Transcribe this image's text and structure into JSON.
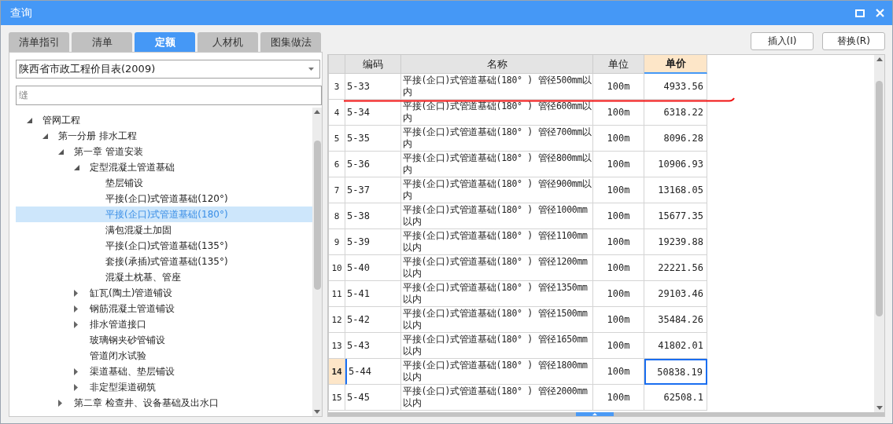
{
  "window": {
    "title": "查询"
  },
  "tabs": [
    {
      "label": "清单指引",
      "selected": false
    },
    {
      "label": "清单",
      "selected": false
    },
    {
      "label": "定额",
      "selected": true
    },
    {
      "label": "人材机",
      "selected": false
    },
    {
      "label": "图集做法",
      "selected": false
    }
  ],
  "buttons": [
    "插入(I)",
    "替换(R)"
  ],
  "library_dropdown": {
    "value": "陕西省市政工程价目表(2009)"
  },
  "search": {
    "value": "缝"
  },
  "tree": [
    {
      "label": "管网工程",
      "expanded": true,
      "selected": false,
      "children": [
        {
          "label": "第一分册 排水工程",
          "expanded": true,
          "selected": false,
          "children": [
            {
              "label": "第一章 管道安装",
              "expanded": true,
              "selected": false,
              "children": [
                {
                  "label": "定型混凝土管道基础",
                  "expanded": true,
                  "selected": false,
                  "children": [
                    {
                      "label": "垫层铺设",
                      "selected": false
                    },
                    {
                      "label": "平接(企口)式管道基础(120°)",
                      "selected": false
                    },
                    {
                      "label": "平接(企口)式管道基础(180°)",
                      "selected": true
                    },
                    {
                      "label": "满包混凝土加固",
                      "selected": false
                    },
                    {
                      "label": "平接(企口)式管道基础(135°)",
                      "selected": false
                    },
                    {
                      "label": "套接(承插)式管道基础(135°)",
                      "selected": false
                    },
                    {
                      "label": "混凝土枕基、管座",
                      "selected": false
                    }
                  ]
                },
                {
                  "label": "缸瓦(陶土)管道铺设",
                  "expanded": false,
                  "selected": false
                },
                {
                  "label": "钢筋混凝土管道铺设",
                  "expanded": false,
                  "selected": false
                },
                {
                  "label": "排水管道接口",
                  "expanded": false,
                  "selected": false
                },
                {
                  "label": "玻璃钢夹砂管铺设",
                  "selected": false
                },
                {
                  "label": "管道闭水试验",
                  "selected": false
                },
                {
                  "label": "渠道基础、垫层铺设",
                  "expanded": false,
                  "selected": false
                },
                {
                  "label": "非定型渠道砌筑",
                  "expanded": false,
                  "selected": false
                }
              ]
            },
            {
              "label": "第二章 检查井、设备基础及出水口",
              "expanded": false,
              "selected": false
            }
          ]
        }
      ]
    }
  ],
  "table": {
    "columns": [
      {
        "label": "编码",
        "selected": false
      },
      {
        "label": "名称",
        "selected": false
      },
      {
        "label": "单位",
        "selected": false
      },
      {
        "label": "单价",
        "selected": true
      }
    ],
    "rows": [
      {
        "index": "3",
        "code": "5-33",
        "name": "平接(企口)式管道基础(180° ) 管径500mm以内",
        "unit": "100m",
        "price": "4933.56",
        "selected": false
      },
      {
        "index": "4",
        "code": "5-34",
        "name": "平接(企口)式管道基础(180° ) 管径600mm以内",
        "unit": "100m",
        "price": "6318.22",
        "selected": false
      },
      {
        "index": "5",
        "code": "5-35",
        "name": "平接(企口)式管道基础(180° ) 管径700mm以内",
        "unit": "100m",
        "price": "8096.28",
        "selected": false
      },
      {
        "index": "6",
        "code": "5-36",
        "name": "平接(企口)式管道基础(180° ) 管径800mm以内",
        "unit": "100m",
        "price": "10906.93",
        "selected": false
      },
      {
        "index": "7",
        "code": "5-37",
        "name": "平接(企口)式管道基础(180° ) 管径900mm以内",
        "unit": "100m",
        "price": "13168.05",
        "selected": false
      },
      {
        "index": "8",
        "code": "5-38",
        "name": "平接(企口)式管道基础(180° ) 管径1000mm以内",
        "unit": "100m",
        "price": "15677.35",
        "selected": false
      },
      {
        "index": "9",
        "code": "5-39",
        "name": "平接(企口)式管道基础(180° ) 管径1100mm以内",
        "unit": "100m",
        "price": "19239.88",
        "selected": false
      },
      {
        "index": "10",
        "code": "5-40",
        "name": "平接(企口)式管道基础(180° ) 管径1200mm以内",
        "unit": "100m",
        "price": "22221.56",
        "selected": false
      },
      {
        "index": "11",
        "code": "5-41",
        "name": "平接(企口)式管道基础(180° ) 管径1350mm以内",
        "unit": "100m",
        "price": "29103.46",
        "selected": false
      },
      {
        "index": "12",
        "code": "5-42",
        "name": "平接(企口)式管道基础(180° ) 管径1500mm以内",
        "unit": "100m",
        "price": "35484.26",
        "selected": false
      },
      {
        "index": "13",
        "code": "5-43",
        "name": "平接(企口)式管道基础(180° ) 管径1650mm以内",
        "unit": "100m",
        "price": "41802.01",
        "selected": false
      },
      {
        "index": "14",
        "code": "5-44",
        "name": "平接(企口)式管道基础(180° ) 管径1800mm以内",
        "unit": "100m",
        "price": "50838.19",
        "selected": true
      },
      {
        "index": "15",
        "code": "5-45",
        "name": "平接(企口)式管道基础(180° ) 管径2000mm以内",
        "unit": "100m",
        "price": "62508.1",
        "selected": false
      }
    ]
  }
}
